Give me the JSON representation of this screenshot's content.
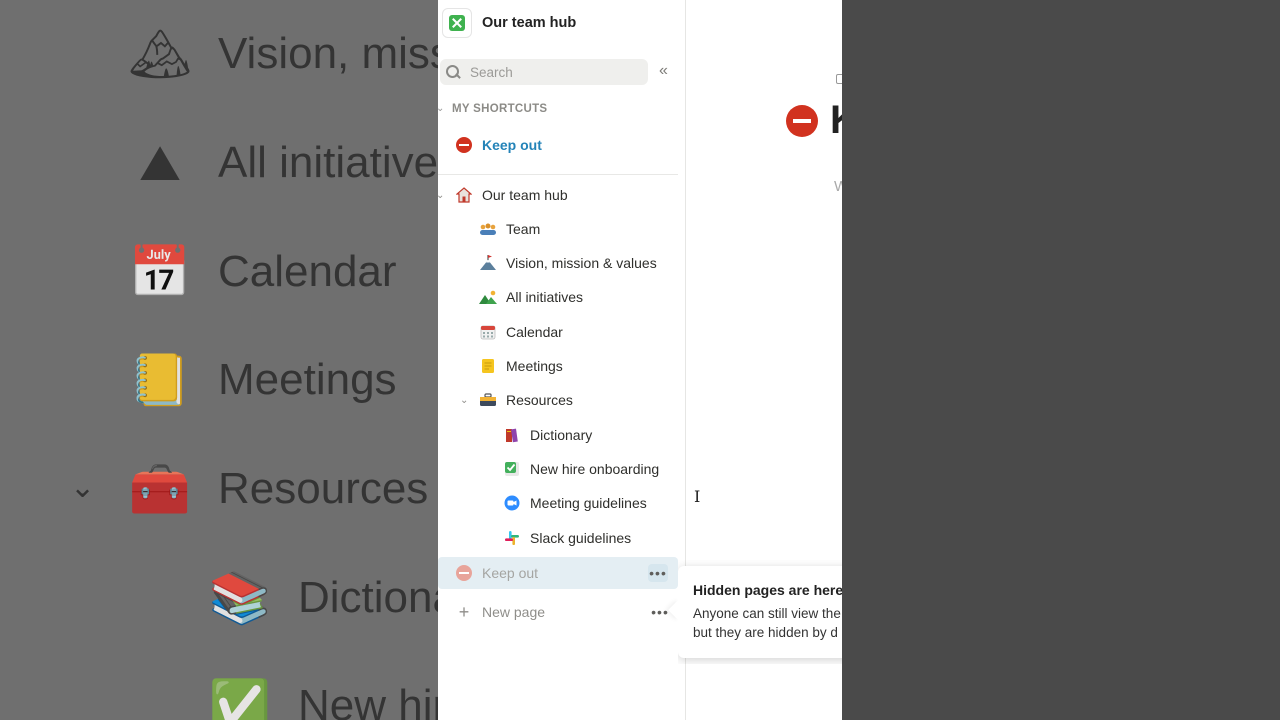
{
  "backdrop": {
    "rows": [
      {
        "icon": "🏔",
        "label": "Vision, miss"
      },
      {
        "icon": "⛰",
        "label": "All initiative"
      },
      {
        "icon": "📅",
        "label": "Calendar"
      },
      {
        "icon": "📒",
        "label": "Meetings"
      },
      {
        "icon": "🧰",
        "label": "Resources"
      },
      {
        "icon": "📚",
        "label": "Dictiona"
      },
      {
        "icon": "✅",
        "label": "New hir"
      }
    ]
  },
  "workspace": {
    "title": "Our team hub"
  },
  "search": {
    "placeholder": "Search"
  },
  "shortcuts": {
    "label": "MY SHORTCUTS",
    "items": [
      {
        "label": "Keep out",
        "color": "#2383b8"
      }
    ]
  },
  "tree": {
    "root": {
      "label": "Our team hub"
    },
    "items": [
      {
        "label": "Team",
        "icon": "team-icon"
      },
      {
        "label": "Vision, mission & values",
        "icon": "mountain-flag-icon"
      },
      {
        "label": "All initiatives",
        "icon": "landscape-icon"
      },
      {
        "label": "Calendar",
        "icon": "calendar-icon"
      },
      {
        "label": "Meetings",
        "icon": "notepad-icon"
      },
      {
        "label": "Resources",
        "icon": "toolbox-icon"
      }
    ],
    "resources_children": [
      {
        "label": "Dictionary",
        "icon": "books-icon"
      },
      {
        "label": "New hire onboarding",
        "icon": "checkbox-icon"
      },
      {
        "label": "Meeting guidelines",
        "icon": "video-camera-icon"
      },
      {
        "label": "Slack guidelines",
        "icon": "slack-icon"
      }
    ]
  },
  "hidden_item": {
    "label": "Keep out",
    "more": "•••"
  },
  "new_page": {
    "label": "New page",
    "more": "•••"
  },
  "main": {
    "title_fragment": "K",
    "sub_fragment": "W"
  },
  "tooltip": {
    "title": "Hidden pages are here",
    "line1": "Anyone can still view the",
    "line2": "but they are hidden by d"
  }
}
